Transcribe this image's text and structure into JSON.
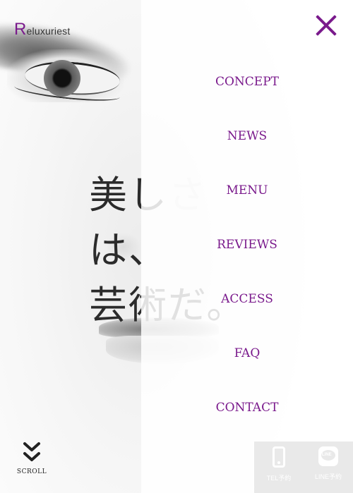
{
  "brand": {
    "initial": "R",
    "rest": "eluxuriest"
  },
  "headline": {
    "line1": "美し",
    "line1_faded": "さ",
    "line2": "は、",
    "line3": "芸術だ。"
  },
  "nav": {
    "items": [
      {
        "label": "CONCEPT"
      },
      {
        "label": "NEWS"
      },
      {
        "label": "MENU"
      },
      {
        "label": "REVIEWS"
      },
      {
        "label": "ACCESS"
      },
      {
        "label": "FAQ"
      },
      {
        "label": "CONTACT"
      }
    ]
  },
  "close": {
    "icon": "close-icon"
  },
  "scroll": {
    "label": "SCROLL",
    "icon": "double-chevron-down-icon"
  },
  "reserve": {
    "tel": {
      "label": "TEL予約",
      "icon": "phone-icon"
    },
    "line": {
      "label": "LINE予約",
      "icon": "line-icon"
    }
  },
  "colors": {
    "accent": "#7a1a8c",
    "bar": "#e9e9e9",
    "text": "#2b2b2b"
  }
}
